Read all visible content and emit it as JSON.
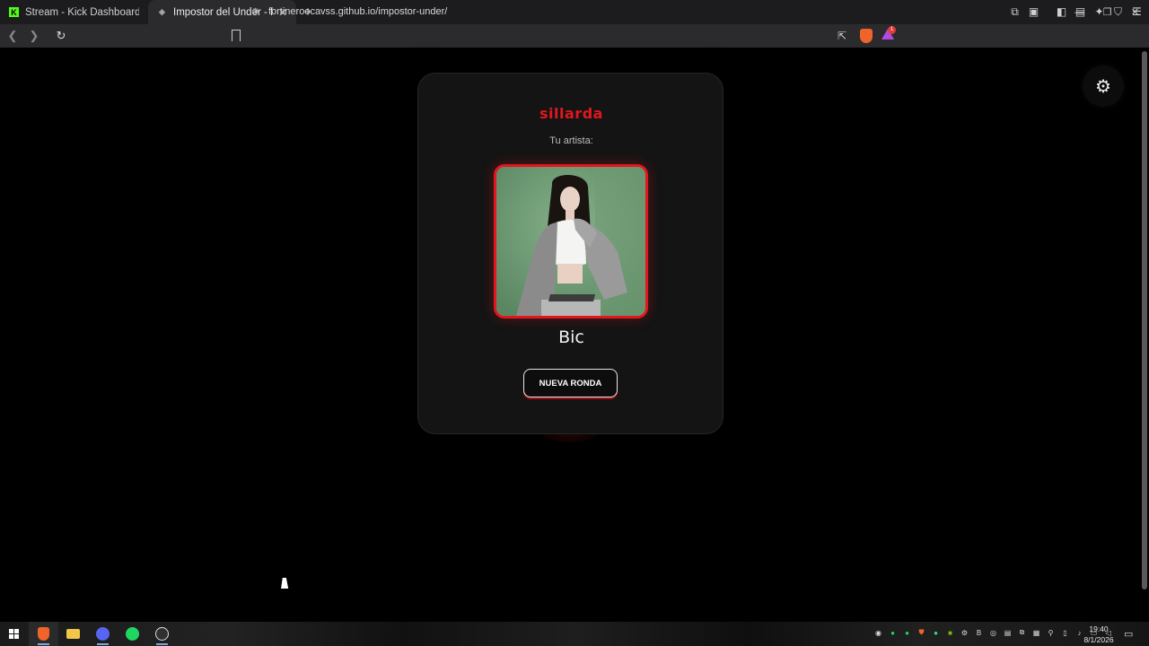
{
  "browser": {
    "tabs": [
      {
        "title": "Stream - Kick Dashboard",
        "active": false
      },
      {
        "title": "Impostor del Under - Premium E",
        "active": true
      }
    ],
    "new_tab_label": "+",
    "url": "fortineroocavss.github.io/impostor-under/",
    "rewards_badge": "1"
  },
  "page": {
    "brand": "sillarda",
    "subtitle": "Tu artista:",
    "artist_name": "Bic",
    "button_label": "NUEVA RONDA",
    "settings_icon": "gear-icon"
  },
  "taskbar": {
    "time": "19:40",
    "date": "8/1/2026"
  },
  "colors": {
    "accent": "#e3161e",
    "card_bg": "#141414",
    "page_bg": "#000000"
  }
}
